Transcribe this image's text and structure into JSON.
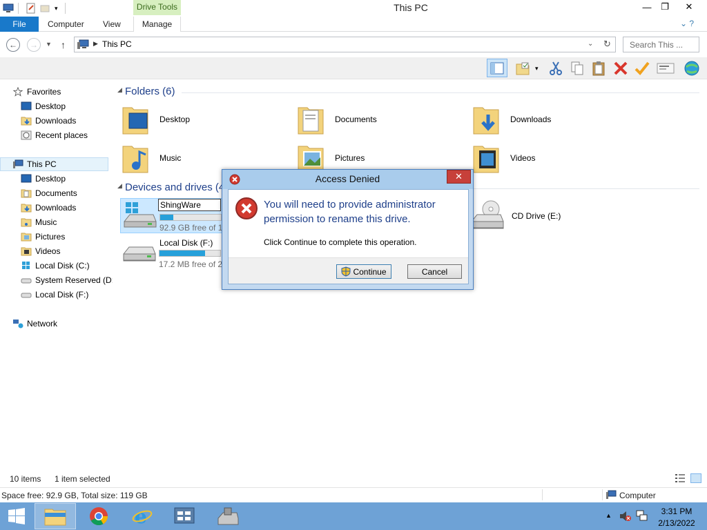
{
  "window": {
    "title": "This PC",
    "contextual_tab": "Drive Tools",
    "minimize": "—",
    "maximize": "❐",
    "close": "✕"
  },
  "ribbon": {
    "tabs": [
      "File",
      "Computer",
      "View",
      "Manage"
    ],
    "help": "⌄ ?"
  },
  "address": {
    "path": "This PC",
    "search_placeholder": "Search This ..."
  },
  "nav_pane": {
    "favorites": "Favorites",
    "favorites_items": [
      "Desktop",
      "Downloads",
      "Recent places"
    ],
    "this_pc": "This PC",
    "this_pc_items": [
      "Desktop",
      "Documents",
      "Downloads",
      "Music",
      "Pictures",
      "Videos",
      "Local Disk (C:)",
      "System Reserved (D:",
      "Local Disk (F:)"
    ],
    "network": "Network"
  },
  "content": {
    "folders_header": "Folders (6)",
    "folders": [
      "Desktop",
      "Documents",
      "Downloads",
      "Music",
      "Pictures",
      "Videos"
    ],
    "devices_header": "Devices and drives (4",
    "drives": [
      {
        "name": "ShingWare",
        "free": "92.9 GB free of 11",
        "used_fraction": 0.22,
        "renaming": true
      },
      {
        "name": "Local Disk (F:)",
        "free": "17.2 MB free of 2",
        "used_fraction": 0.75,
        "renaming": false
      },
      {
        "name": "CD Drive (E:)"
      }
    ]
  },
  "dialog": {
    "title": "Access Denied",
    "close": "✕",
    "main_text": "You will need to provide administrator permission to rename this drive.",
    "sub_text": "Click Continue to complete this operation.",
    "continue_label": "Continue",
    "cancel_label": "Cancel"
  },
  "status": {
    "items": "10 items",
    "selected": "1 item selected",
    "space": "Space free: 92.9 GB, Total size: 119 GB",
    "location": "Computer"
  },
  "taskbar": {
    "time": "3:31 PM",
    "date": "2/13/2022"
  },
  "colors": {
    "accent": "#1979ca",
    "header_blue": "#1e3f8a",
    "taskbar": "#6ea2d6",
    "drive_fill": "#26a0da",
    "error_red": "#c7403a"
  }
}
